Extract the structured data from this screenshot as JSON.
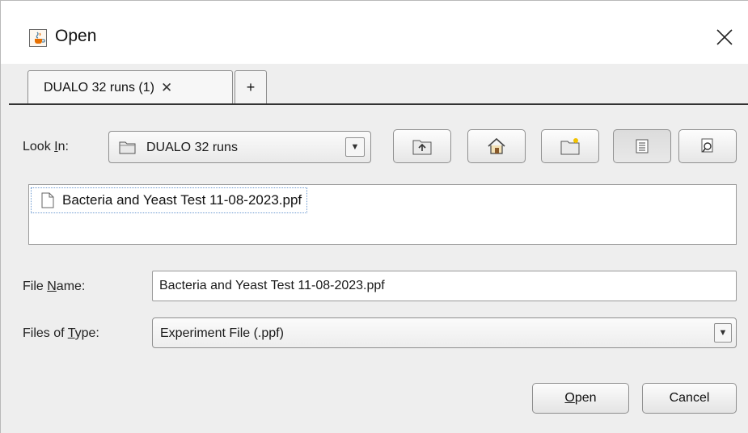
{
  "window": {
    "title": "Open",
    "icon": "java-cup-icon",
    "close_icon": "close-icon"
  },
  "tabs": [
    {
      "label": "DUALO 32 runs (1)",
      "close_glyph": "✕"
    },
    {
      "label": "+"
    }
  ],
  "look_in": {
    "label_pre": "Look ",
    "label_mnemonic": "I",
    "label_post": "n:",
    "value": "DUALO 32 runs"
  },
  "toolbar_icons": [
    "up-folder-icon",
    "home-icon",
    "new-folder-icon",
    "list-view-icon",
    "details-view-icon"
  ],
  "files": [
    {
      "name": "Bacteria and Yeast Test 11-08-2023.ppf",
      "icon": "file-icon"
    }
  ],
  "file_name": {
    "label_pre": "File ",
    "label_mnemonic": "N",
    "label_post": "ame:",
    "value": "Bacteria and Yeast Test 11-08-2023.ppf"
  },
  "file_type": {
    "label_pre": "Files of ",
    "label_mnemonic": "T",
    "label_post": "ype:",
    "value": "Experiment File (.ppf)"
  },
  "buttons": {
    "open_mnemonic": "O",
    "open_rest": "pen",
    "cancel": "Cancel"
  }
}
